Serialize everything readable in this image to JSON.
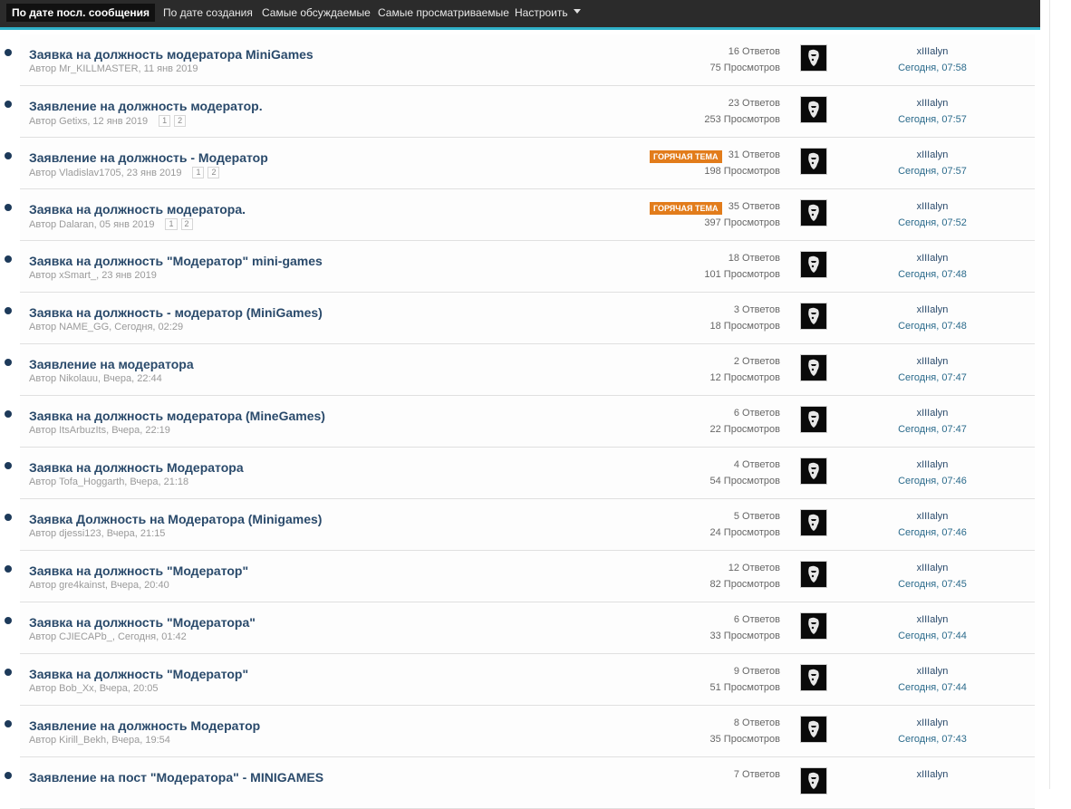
{
  "sort_tabs": [
    {
      "label": "По дате посл. сообщения",
      "active": true
    },
    {
      "label": "По дате создания"
    },
    {
      "label": "Самые обсуждаемые"
    },
    {
      "label": "Самые просматриваемые"
    },
    {
      "label": "Настроить",
      "has_dropdown": true
    }
  ],
  "hot_label": "ГОРЯЧАЯ ТЕМА",
  "topics": [
    {
      "title": "Заявка на должность модератора MiniGames",
      "meta": "Автор Mr_KILLMASTER, 11 янв 2019",
      "pages": [],
      "hot": false,
      "replies": "16 Ответов",
      "views": "75 Просмотров",
      "last_user": "xIIIalyn",
      "last_time": "Сегодня, 07:58"
    },
    {
      "title": "Заявление на должность модератор.",
      "meta": "Автор Getixs, 12 янв 2019",
      "pages": [
        "1",
        "2"
      ],
      "hot": false,
      "replies": "23 Ответов",
      "views": "253 Просмотров",
      "last_user": "xIIIalyn",
      "last_time": "Сегодня, 07:57"
    },
    {
      "title": "Заявление на должность - Модератор",
      "meta": "Автор Vladislav1705, 23 янв 2019",
      "pages": [
        "1",
        "2"
      ],
      "hot": true,
      "replies": "31 Ответов",
      "views": "198 Просмотров",
      "last_user": "xIIIalyn",
      "last_time": "Сегодня, 07:57"
    },
    {
      "title": "Заявка на должность модератора.",
      "meta": "Автор Dalaran, 05 янв 2019",
      "pages": [
        "1",
        "2"
      ],
      "hot": true,
      "replies": "35 Ответов",
      "views": "397 Просмотров",
      "last_user": "xIIIalyn",
      "last_time": "Сегодня, 07:52"
    },
    {
      "title": "Заявка на должность \"Модератор\" mini-games",
      "meta": "Автор xSmart_, 23 янв 2019",
      "pages": [],
      "hot": false,
      "replies": "18 Ответов",
      "views": "101 Просмотров",
      "last_user": "xIIIalyn",
      "last_time": "Сегодня, 07:48"
    },
    {
      "title": "Заявка на должность - модератор (MiniGames)",
      "meta": "Автор NAME_GG, Сегодня, 02:29",
      "pages": [],
      "hot": false,
      "replies": "3 Ответов",
      "views": "18 Просмотров",
      "last_user": "xIIIalyn",
      "last_time": "Сегодня, 07:48"
    },
    {
      "title": "Заявление на модератора",
      "meta": "Автор Nikolauu, Вчера, 22:44",
      "pages": [],
      "hot": false,
      "replies": "2 Ответов",
      "views": "12 Просмотров",
      "last_user": "xIIIalyn",
      "last_time": "Сегодня, 07:47"
    },
    {
      "title": "Заявка на должность модератора (MineGames)",
      "meta": "Автор ItsArbuzIts, Вчера, 22:19",
      "pages": [],
      "hot": false,
      "replies": "6 Ответов",
      "views": "22 Просмотров",
      "last_user": "xIIIalyn",
      "last_time": "Сегодня, 07:47"
    },
    {
      "title": "Заявка на должность Модератора",
      "meta": "Автор Tofa_Hoggarth, Вчера, 21:18",
      "pages": [],
      "hot": false,
      "replies": "4 Ответов",
      "views": "54 Просмотров",
      "last_user": "xIIIalyn",
      "last_time": "Сегодня, 07:46"
    },
    {
      "title": "Заявка Должность на Модератора (Minigames)",
      "meta": "Автор djessi123, Вчера, 21:15",
      "pages": [],
      "hot": false,
      "replies": "5 Ответов",
      "views": "24 Просмотров",
      "last_user": "xIIIalyn",
      "last_time": "Сегодня, 07:46"
    },
    {
      "title": "Заявка на должность \"Модератор\"",
      "meta": "Автор gre4kainst, Вчера, 20:40",
      "pages": [],
      "hot": false,
      "replies": "12 Ответов",
      "views": "82 Просмотров",
      "last_user": "xIIIalyn",
      "last_time": "Сегодня, 07:45"
    },
    {
      "title": "Заявка на должность \"Модератора\"",
      "meta": "Автор CJIECAPb_, Сегодня, 01:42",
      "pages": [],
      "hot": false,
      "replies": "6 Ответов",
      "views": "33 Просмотров",
      "last_user": "xIIIalyn",
      "last_time": "Сегодня, 07:44"
    },
    {
      "title": "Заявка на должность \"Модератор\"",
      "meta": "Автор Bob_Xx, Вчера, 20:05",
      "pages": [],
      "hot": false,
      "replies": "9 Ответов",
      "views": "51 Просмотров",
      "last_user": "xIIIalyn",
      "last_time": "Сегодня, 07:44"
    },
    {
      "title": "Заявление на должность Модератор",
      "meta": "Автор Kirill_Bekh, Вчера, 19:54",
      "pages": [],
      "hot": false,
      "replies": "8 Ответов",
      "views": "35 Просмотров",
      "last_user": "xIIIalyn",
      "last_time": "Сегодня, 07:43"
    },
    {
      "title": "Заявление на пост \"Модератора\" - MINIGAMES",
      "meta": "",
      "pages": [],
      "hot": false,
      "replies": "7 Ответов",
      "views": "",
      "last_user": "xIIIalyn",
      "last_time": ""
    }
  ]
}
